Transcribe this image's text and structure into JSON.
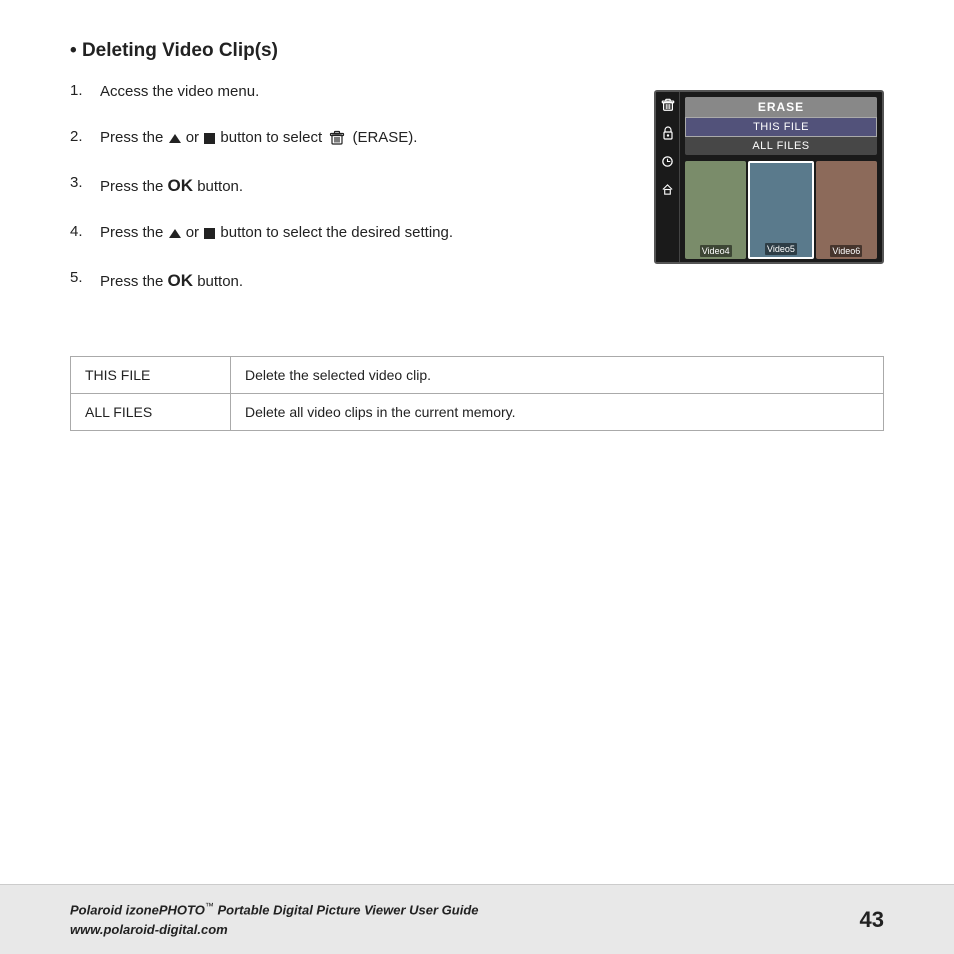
{
  "page": {
    "title": "Deleting Video Clip(s)",
    "bullet": "•",
    "steps": [
      {
        "num": "1.",
        "text": "Access the video menu."
      },
      {
        "num": "2.",
        "text_parts": [
          "Press the",
          "or",
          "button to select",
          "(ERASE)."
        ],
        "has_icons": true
      },
      {
        "num": "3.",
        "text_parts": [
          "Press the",
          "button."
        ],
        "has_ok": true
      },
      {
        "num": "4.",
        "text_parts": [
          "Press the",
          "or",
          "button to select the desired setting."
        ],
        "has_icons": true
      },
      {
        "num": "5.",
        "text_parts": [
          "Press the",
          "button."
        ],
        "has_ok": true
      }
    ],
    "camera_screen": {
      "erase_label": "ERASE",
      "this_file": "THIS FILE",
      "all_files": "ALL FILES",
      "video4": "Video4",
      "video5": "Video5",
      "video6": "Video6"
    },
    "table": {
      "rows": [
        {
          "option": "THIS FILE",
          "description": "Delete the selected video clip."
        },
        {
          "option": "ALL FILES",
          "description": "Delete all video clips in the current memory."
        }
      ]
    },
    "footer": {
      "brand": "Polaroid izonePHOTO",
      "tm": "™",
      "subtitle": "Portable Digital Picture Viewer User Guide",
      "url": "www.polaroid-digital.com",
      "page_number": "43"
    }
  }
}
